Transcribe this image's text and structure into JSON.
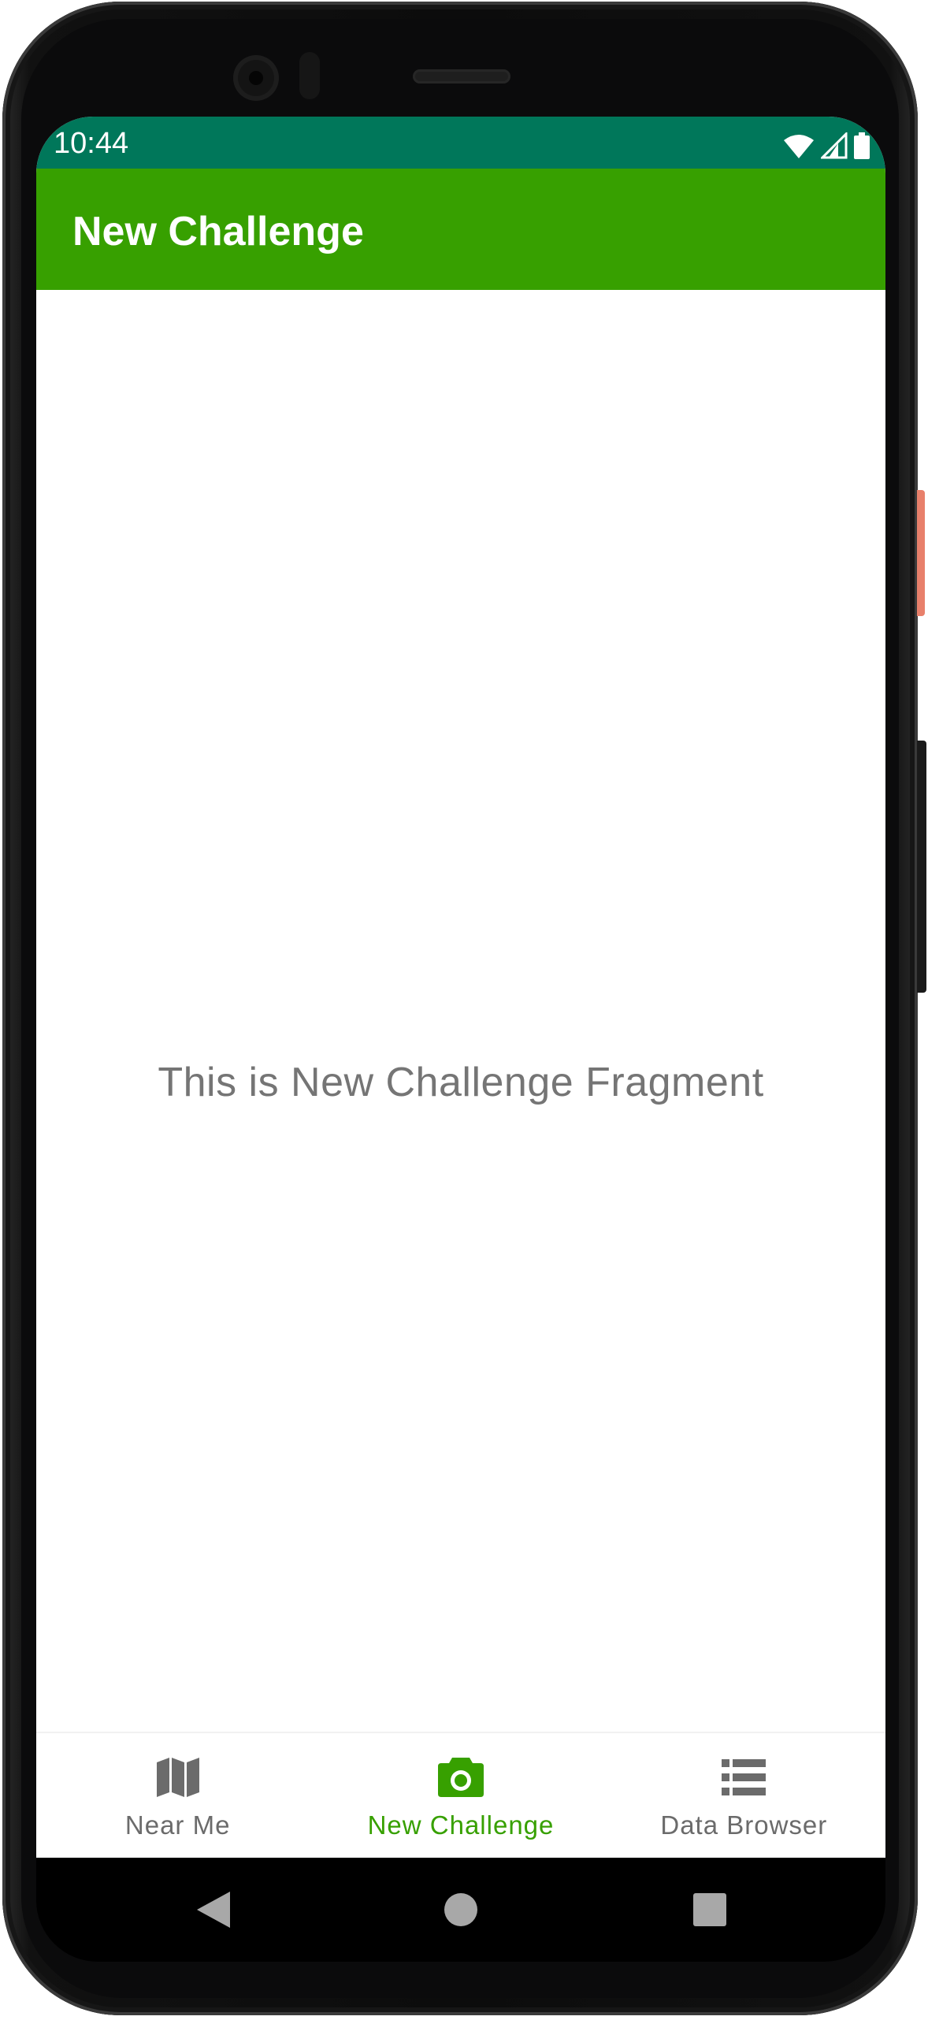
{
  "status_bar": {
    "time": "10:44",
    "icons": [
      "wifi-icon",
      "cell-signal-icon",
      "battery-icon"
    ]
  },
  "app_bar": {
    "title": "New Challenge"
  },
  "content": {
    "message": "This is New Challenge Fragment"
  },
  "bottom_nav": {
    "items": [
      {
        "label": "Near Me",
        "icon": "map-icon",
        "active": false
      },
      {
        "label": "New Challenge",
        "icon": "camera-icon",
        "active": true
      },
      {
        "label": "Data Browser",
        "icon": "list-icon",
        "active": false
      }
    ]
  },
  "system_nav": {
    "buttons": [
      "back-icon",
      "home-icon",
      "recents-icon"
    ]
  },
  "colors": {
    "status_bar": "#00775a",
    "app_bar": "#37a000",
    "active_nav": "#37a000",
    "inactive_nav": "#6b6b6b",
    "fragment_text": "#757575"
  }
}
